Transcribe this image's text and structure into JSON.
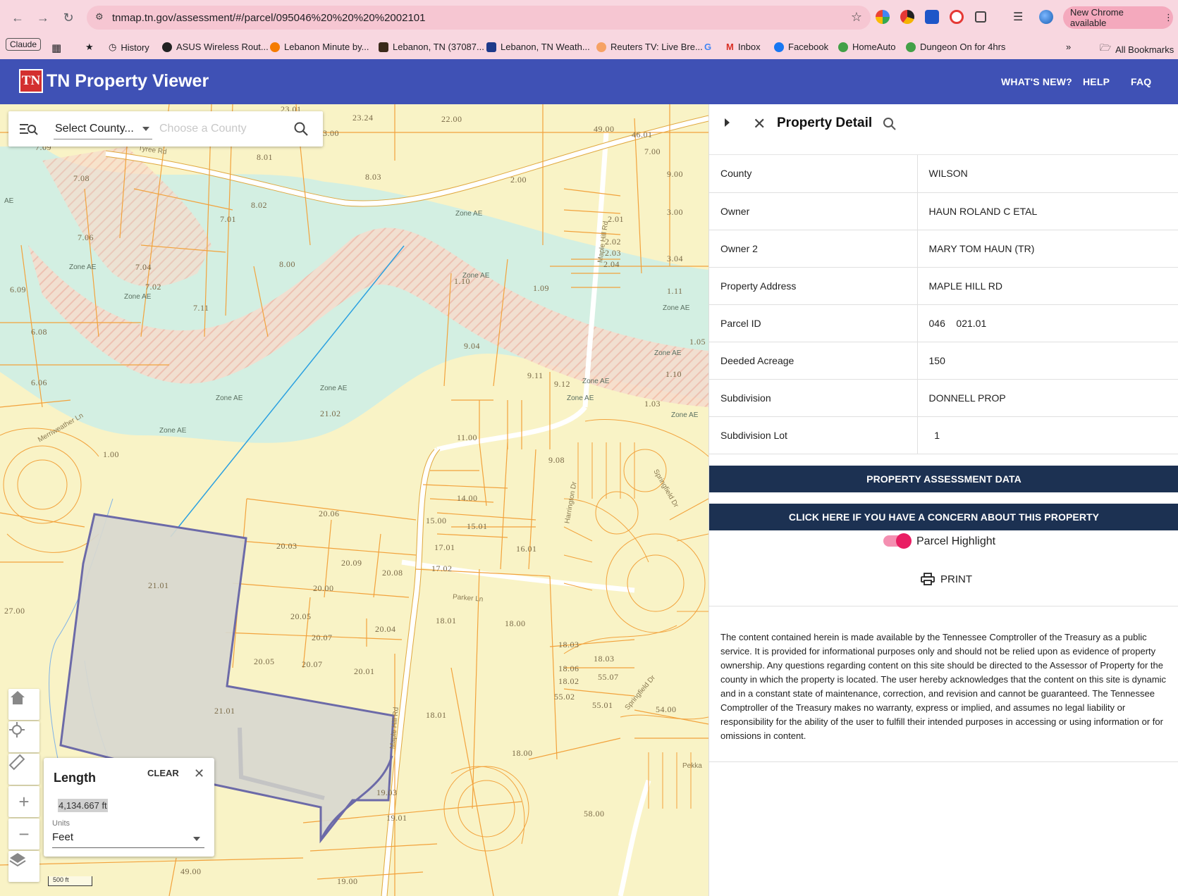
{
  "browser": {
    "url": "tnmap.tn.gov/assessment/#/parcel/095046%20%20%20%2002101",
    "new_chrome": "New Chrome available",
    "profile_chip": "Claude",
    "bookmarks": [
      "History",
      "ASUS Wireless Rout...",
      "Lebanon Minute by...",
      "Lebanon, TN (37087...",
      "Lebanon, TN Weath...",
      "Reuters TV: Live Bre...",
      "Inbox",
      "Facebook",
      "HomeAuto",
      "Dungeon On for 4hrs"
    ],
    "all_bookmarks": "All Bookmarks"
  },
  "app": {
    "logo": "TN",
    "title": "TN Property Viewer",
    "nav": [
      "WHAT'S NEW?",
      "HELP",
      "FAQ"
    ]
  },
  "map": {
    "county_select": "Select County...",
    "county_placeholder": "Choose a County",
    "parcel_labels": [
      "23.01",
      "23.24",
      "22.00",
      "49.00",
      "46.01",
      "7.00",
      "3.00",
      "8.01",
      "8.03",
      "2.00",
      "9.00",
      "8.02",
      "7.01",
      "2.01",
      "3.00",
      "2.02",
      "2.03",
      "2.04",
      "3.04",
      "8.00",
      "7.02",
      "7.11",
      "1.09",
      "1.11",
      "6.09",
      "6.08",
      "9.04",
      "9.11",
      "9.12",
      "1.05",
      "1.10",
      "6.06",
      "21.02",
      "1.03",
      "11.00",
      "9.08",
      "1.00",
      "14.00",
      "20.06",
      "15.00",
      "15.01",
      "20.03",
      "17.01",
      "16.01",
      "20.09",
      "17.02",
      "20.08",
      "21.01",
      "20.00",
      "27.00",
      "18.01",
      "18.00",
      "20.05",
      "20.04",
      "20.07",
      "18.03",
      "18.03",
      "20.05",
      "20.07",
      "20.01",
      "18.06",
      "55.07",
      "18.02",
      "55.02",
      "55.01",
      "54.00",
      "21.01",
      "18.01",
      "18.00",
      "19.03",
      "58.00",
      "19.01",
      "49.00",
      "19.00",
      "7.09",
      "7.08",
      "7.06",
      "7.04",
      "1.10"
    ],
    "zone_labels": [
      "Zone AE",
      "Zone AE",
      "Zone AE",
      "Zone AE",
      "Zone AE",
      "Zone AE",
      "Zone AE",
      "Zone AE",
      "Zone AE",
      "Zone AE",
      "Zone AE",
      "Zone AE",
      "AE"
    ],
    "street_labels": [
      "Tyree Rd",
      "Maple Hill Rd",
      "Merriweather Ln",
      "Harrington Dr",
      "Springfield Dr",
      "Parker Ln",
      "Maple Hill Rd",
      "Springfield Dr",
      "Pekka"
    ],
    "measure": {
      "title": "Length",
      "clear": "CLEAR",
      "value": "4,134.667 ft",
      "units_label": "Units",
      "units": "Feet"
    },
    "scale": "500 ft"
  },
  "panel": {
    "title": "Property Detail",
    "rows": [
      {
        "key": "County",
        "value": "WILSON"
      },
      {
        "key": "Owner",
        "value": "HAUN ROLAND C ETAL"
      },
      {
        "key": "Owner 2",
        "value": "MARY TOM HAUN (TR)"
      },
      {
        "key": "Property Address",
        "value": "MAPLE HILL RD"
      },
      {
        "key": "Parcel ID",
        "value": "046    021.01"
      },
      {
        "key": "Deeded Acreage",
        "value": "150"
      },
      {
        "key": "Subdivision",
        "value": "DONNELL PROP"
      },
      {
        "key": "Subdivision Lot",
        "value": "  1"
      }
    ],
    "assessment_btn": "PROPERTY ASSESSMENT DATA",
    "concern_btn": "CLICK HERE IF YOU HAVE A CONCERN ABOUT THIS PROPERTY",
    "highlight_label": "Parcel Highlight",
    "highlight_on": true,
    "print": "PRINT",
    "disclaimer": "The content contained herein is made available by the Tennessee Comptroller of the Treasury as a public service. It is provided for informational purposes only and should not be relied upon as evidence of property ownership. Any questions regarding content on this site should be directed to the Assessor of Property for the county in which the property is located. The user hereby acknowledges that the content on this site is dynamic and in a constant state of maintenance, correction, and revision and cannot be guaranteed. The Tennessee Comptroller of the Treasury makes no warranty, express or implied, and assumes no legal liability or responsibility for the ability of the user to fulfill their intended purposes in accessing or using information or for omissions in content."
  }
}
